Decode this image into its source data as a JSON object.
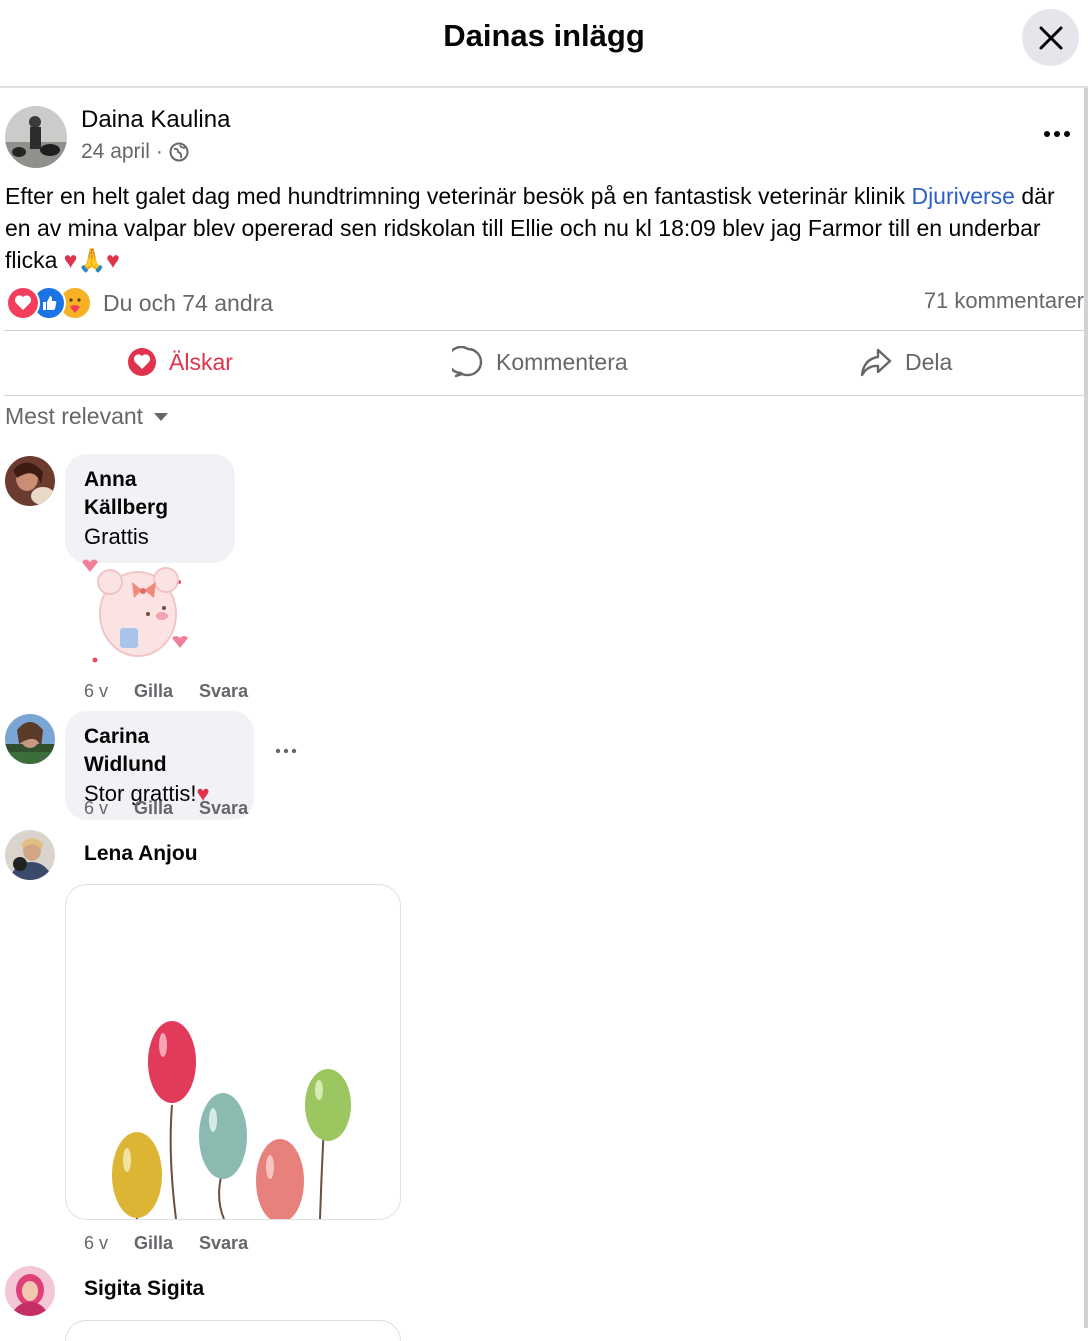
{
  "dialog": {
    "title": "Dainas inlägg",
    "close_icon": "close-icon"
  },
  "post": {
    "author": "Daina Kaulina",
    "date": "24 april",
    "separator": "·",
    "audience_icon": "globe-icon",
    "text_before_link": "Efter en helt galet dag med hundtrimning  veterinär besök  på en fantastisk veterinär klinik ",
    "link_text": "Djuriverse",
    "text_after_link": " där en av mina valpar blev opererad sen ridskolan till Ellie och nu kl 18:09 blev jag Farmor till en underbar flicka ",
    "emojis": "♥🙏♥",
    "reactions_text": "Du och 74 andra",
    "reaction_icons": [
      "love-icon",
      "like-icon",
      "care-icon"
    ],
    "comments_count": "71 kommentarer"
  },
  "actions": {
    "love": "Älskar",
    "comment": "Kommentera",
    "share": "Dela"
  },
  "sort_label": "Mest relevant",
  "comments": [
    {
      "name": "Anna Källberg",
      "text": "Grattis",
      "time": "6 v",
      "like": "Gilla",
      "reply": "Svara",
      "attachment": "sticker"
    },
    {
      "name": "Carina Widlund",
      "text": "Stor grattis!",
      "emoji": "♥",
      "time": "6 v",
      "like": "Gilla",
      "reply": "Svara"
    },
    {
      "name": "Lena Anjou",
      "time": "6 v",
      "like": "Gilla",
      "reply": "Svara",
      "attachment": "balloons-gif"
    },
    {
      "name": "Sigita Sigita"
    }
  ],
  "colors": {
    "accent_love": "#e0324b",
    "link": "#2d5fc8",
    "muted": "#65676b",
    "bubble": "#f0f2f5"
  }
}
